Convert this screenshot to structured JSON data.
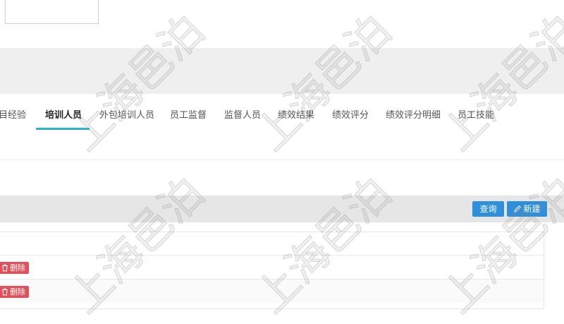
{
  "tabs": [
    {
      "label": "目经验",
      "active": false
    },
    {
      "label": "培训人员",
      "active": true
    },
    {
      "label": "外包培训人员",
      "active": false
    },
    {
      "label": "员工监督",
      "active": false
    },
    {
      "label": "监督人员",
      "active": false
    },
    {
      "label": "绩效结果",
      "active": false
    },
    {
      "label": "绩效评分",
      "active": false
    },
    {
      "label": "绩效评分明细",
      "active": false
    },
    {
      "label": "员工技能",
      "active": false
    }
  ],
  "toolbar": {
    "query_label": "查询",
    "new_label": "新建",
    "new_icon": "pencil-icon"
  },
  "rows": [
    {
      "delete_label": "删除",
      "delete_icon": "trash-icon"
    },
    {
      "delete_label": "删除",
      "delete_icon": "trash-icon"
    }
  ],
  "watermark": "上海邑泊",
  "colors": {
    "accent": "#29b6c9",
    "primary_button": "#2f8fd8",
    "danger_button": "#e0505a",
    "band": "#efefef",
    "toolbar_bg": "#e6e6e6"
  }
}
